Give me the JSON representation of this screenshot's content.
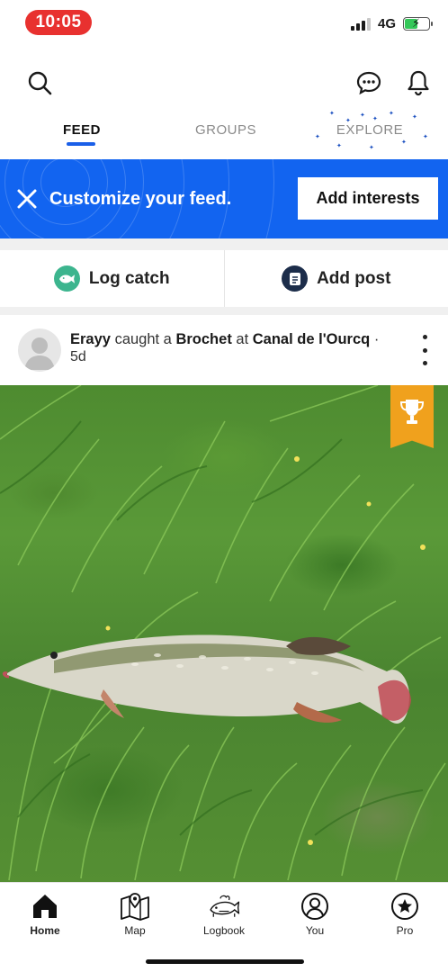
{
  "status": {
    "time": "10:05",
    "network": "4G"
  },
  "tabs": [
    {
      "label": "FEED",
      "active": true
    },
    {
      "label": "GROUPS",
      "active": false
    },
    {
      "label": "EXPLORE",
      "active": false
    }
  ],
  "banner": {
    "text": "Customize your feed.",
    "button_label": "Add interests"
  },
  "actions": {
    "log_catch": "Log catch",
    "add_post": "Add post"
  },
  "post": {
    "user": "Erayy",
    "verb": "caught a",
    "species": "Brochet",
    "preposition": "at",
    "location": "Canal de l'Ourcq",
    "separator": "·",
    "time_ago": "5d"
  },
  "nav": [
    {
      "label": "Home",
      "icon": "home-icon",
      "active": true
    },
    {
      "label": "Map",
      "icon": "map-icon",
      "active": false
    },
    {
      "label": "Logbook",
      "icon": "logbook-fish-icon",
      "active": false
    },
    {
      "label": "You",
      "icon": "profile-icon",
      "active": false
    },
    {
      "label": "Pro",
      "icon": "star-icon",
      "active": false
    }
  ],
  "colors": {
    "accent": "#1264f0",
    "trophy": "#f0a11d",
    "time_pill": "#e8312f",
    "log_catch_icon": "#3cb58e",
    "add_post_icon": "#1c2d4a"
  }
}
